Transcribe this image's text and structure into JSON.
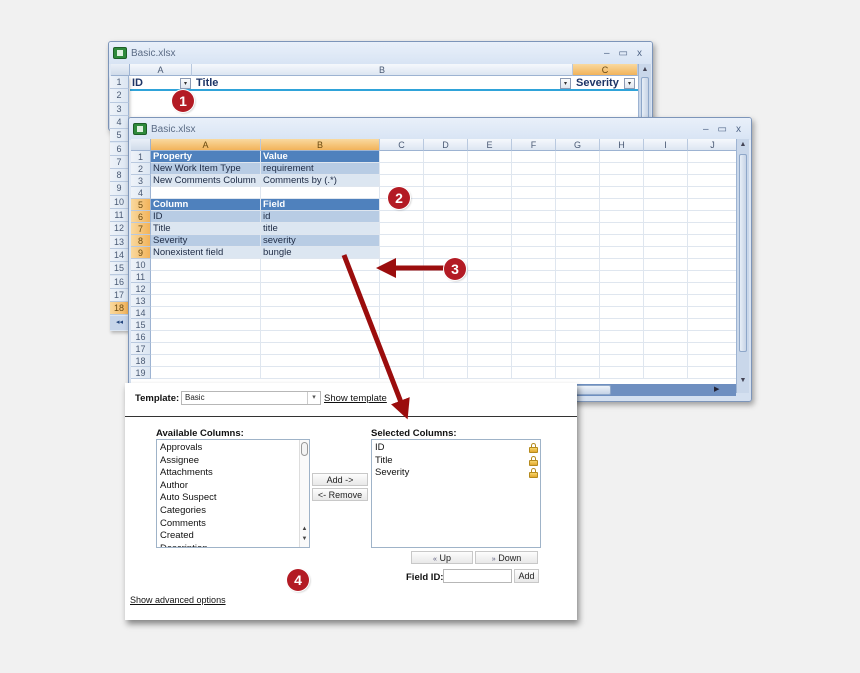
{
  "back_window": {
    "title": "Basic.xlsx",
    "controls": {
      "minimize": "–",
      "maximize": "▭",
      "close": "x"
    },
    "columns": [
      "A",
      "B",
      "C"
    ],
    "selected_column": "C",
    "header_row": [
      {
        "label": "ID",
        "filter_icon": "▾"
      },
      {
        "label": "Title",
        "filter_icon": "▾"
      },
      {
        "label": "Severity",
        "filter_icon": "▾"
      }
    ],
    "row_numbers": [
      "1",
      "2",
      "3",
      "4",
      "5",
      "6",
      "7",
      "8",
      "9",
      "10",
      "11",
      "12",
      "13",
      "14",
      "15",
      "16",
      "17",
      "18"
    ],
    "selected_row": "18",
    "sheet_nav": "◂◂"
  },
  "front_window": {
    "title": "Basic.xlsx",
    "controls": {
      "minimize": "–",
      "maximize": "▭",
      "close": "x"
    },
    "columns": [
      "A",
      "B",
      "C",
      "D",
      "E",
      "F",
      "G",
      "H",
      "I",
      "J"
    ],
    "row_numbers": [
      "1",
      "2",
      "3",
      "4",
      "5",
      "6",
      "7",
      "8",
      "9",
      "10",
      "11",
      "12",
      "13",
      "14",
      "15",
      "16",
      "17",
      "18",
      "19"
    ],
    "selected_rows": [
      "5",
      "6",
      "7",
      "8",
      "9"
    ],
    "rows": [
      {
        "a": "Property",
        "b": "Value",
        "style": "hdr"
      },
      {
        "a": "New Work Item Type",
        "b": "requirement",
        "style": "band1"
      },
      {
        "a": "New Comments Column",
        "b": "Comments by (.*)",
        "style": "band2"
      },
      {
        "a": "",
        "b": "",
        "style": ""
      },
      {
        "a": "Column",
        "b": "Field",
        "style": "hdr"
      },
      {
        "a": "ID",
        "b": "id",
        "style": "band1"
      },
      {
        "a": "Title",
        "b": "title",
        "style": "band2"
      },
      {
        "a": "Severity",
        "b": "severity",
        "style": "band1"
      },
      {
        "a": "Nonexistent field",
        "b": "bungle",
        "style": "band2"
      }
    ]
  },
  "dialog": {
    "template_label": "Template:",
    "template_value": "Basic",
    "show_template": "Show template",
    "available_label": "Available Columns:",
    "available_items": [
      "Approvals",
      "Assignee",
      "Attachments",
      "Author",
      "Auto Suspect",
      "Categories",
      "Comments",
      "Created",
      "Description"
    ],
    "selected_label": "Selected Columns:",
    "selected_items": [
      "ID",
      "Title",
      "Severity"
    ],
    "add_button": "Add ->",
    "remove_button": "<- Remove",
    "up_button": "Up",
    "up_icon": "«",
    "down_button": "Down",
    "down_icon": "»",
    "field_id_label": "Field ID:",
    "field_id_value": "",
    "field_add_button": "Add",
    "advanced_link": "Show advanced options"
  },
  "callouts": [
    "1",
    "2",
    "3",
    "4"
  ],
  "colors": {
    "callout": "#b31b24",
    "arrow": "#9b0d0d",
    "table_header": "#4f81bd",
    "band1": "#b8cce4",
    "band2": "#dce6f1",
    "selected_header": "#f2b35a"
  }
}
